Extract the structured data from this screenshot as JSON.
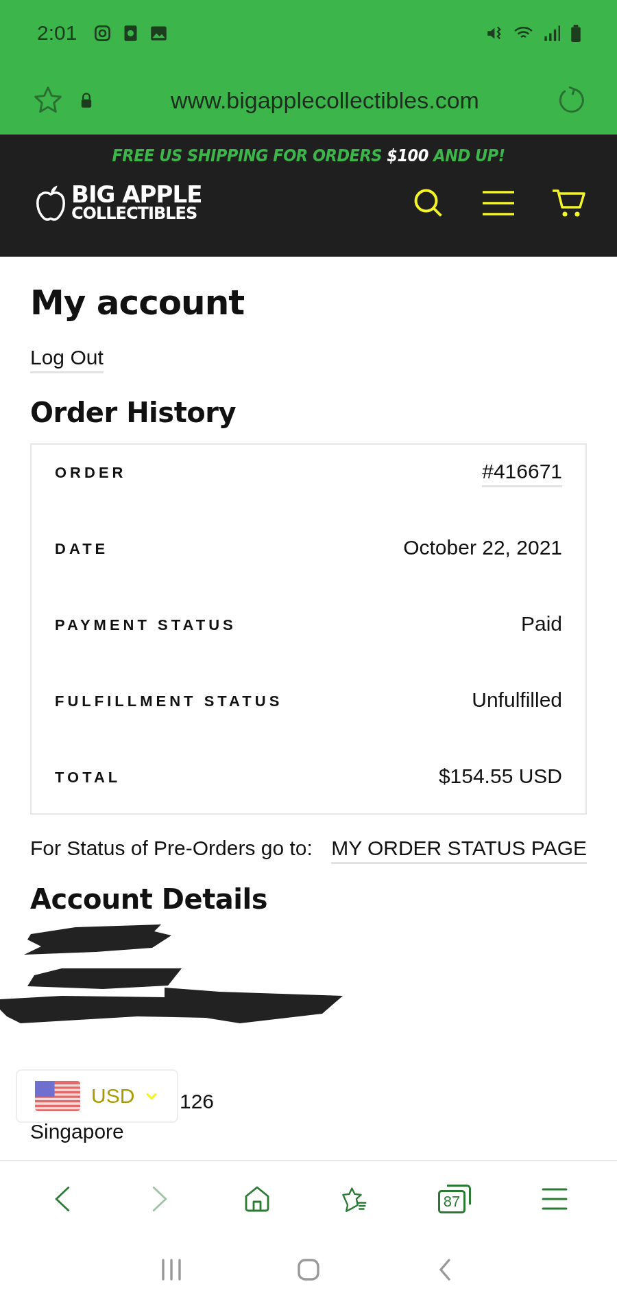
{
  "status_bar": {
    "time": "2:01"
  },
  "browser_bar": {
    "url": "www.bigapplecollectibles.com"
  },
  "promo": {
    "before": "FREE US SHIPPING FOR ORDERS ",
    "highlight": "$100",
    "after": " AND UP!"
  },
  "logo": {
    "line_1": "BIG APPLE",
    "line_2": "COLLECTIBLES"
  },
  "page_title": "My account",
  "logout_link": "Log Out",
  "order_history": {
    "title": "Order History",
    "rows": [
      {
        "label": "ORDER",
        "value": "#416671",
        "kind": "link"
      },
      {
        "label": "DATE",
        "value": "October 22, 2021",
        "kind": "text"
      },
      {
        "label": "PAYMENT STATUS",
        "value": "Paid",
        "kind": "text"
      },
      {
        "label": "FULFILLMENT STATUS",
        "value": "Unfulfilled",
        "kind": "text"
      },
      {
        "label": "TOTAL",
        "value": "$154.55 USD",
        "kind": "text"
      }
    ]
  },
  "preorder_note": {
    "text": "For Status of Pre-Orders go to: ",
    "link": "MY ORDER STATUS PAGE"
  },
  "account_details": {
    "title": "Account Details",
    "lines": [
      "126",
      "Singapore"
    ]
  },
  "currency": {
    "code": "USD"
  },
  "browser_nav": [
    {
      "kind": "back",
      "disabled": false
    },
    {
      "kind": "forward",
      "disabled": true
    },
    {
      "kind": "home",
      "disabled": false
    },
    {
      "kind": "bookmarks",
      "disabled": false
    },
    {
      "kind": "tabs",
      "count": "87",
      "disabled": false
    },
    {
      "kind": "menu",
      "disabled": false
    }
  ]
}
